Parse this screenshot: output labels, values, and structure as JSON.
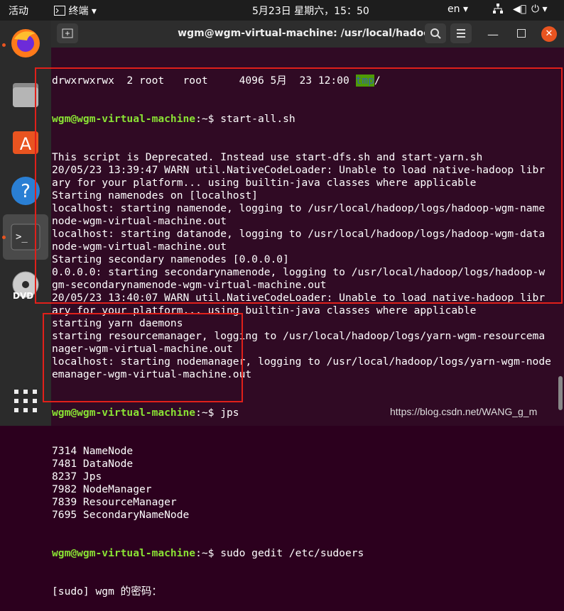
{
  "topbar": {
    "activities": "活动",
    "app_menu": "终端",
    "clock": "5月23日 星期六，15：50",
    "lang": "en"
  },
  "dock": {
    "apps": [
      "firefox-icon",
      "files-icon",
      "software-center-icon",
      "help-icon",
      "terminal-icon",
      "dvd-icon"
    ]
  },
  "window": {
    "title": "wgm@wgm-virtual-machine: /usr/local/hadoop"
  },
  "terminal": {
    "prompt": "wgm@wgm-virtual-machine",
    "path_sep": ":~$",
    "listing_prefix": "drwxrwxrwx  2 root   root     4096 5月  23 12:00 ",
    "listing_name": "tmp",
    "listing_suffix": "/",
    "cmd1": " start-all.sh",
    "out1": [
      "This script is Deprecated. Instead use start-dfs.sh and start-yarn.sh",
      "20/05/23 13:39:47 WARN util.NativeCodeLoader: Unable to load native-hadoop libr",
      "ary for your platform... using builtin-java classes where applicable",
      "Starting namenodes on [localhost]",
      "localhost: starting namenode, logging to /usr/local/hadoop/logs/hadoop-wgm-name",
      "node-wgm-virtual-machine.out",
      "localhost: starting datanode, logging to /usr/local/hadoop/logs/hadoop-wgm-data",
      "node-wgm-virtual-machine.out",
      "Starting secondary namenodes [0.0.0.0]",
      "0.0.0.0: starting secondarynamenode, logging to /usr/local/hadoop/logs/hadoop-w",
      "gm-secondarynamenode-wgm-virtual-machine.out",
      "20/05/23 13:40:07 WARN util.NativeCodeLoader: Unable to load native-hadoop libr",
      "ary for your platform... using builtin-java classes where applicable",
      "starting yarn daemons",
      "starting resourcemanager, logging to /usr/local/hadoop/logs/yarn-wgm-resourcema",
      "nager-wgm-virtual-machine.out",
      "localhost: starting nodemanager, logging to /usr/local/hadoop/logs/yarn-wgm-node",
      "emanager-wgm-virtual-machine.out"
    ],
    "cmd2": " jps",
    "out2": [
      "7314 NameNode",
      "7481 DataNode",
      "8237 Jps",
      "7982 NodeManager",
      "7839 ResourceManager",
      "7695 SecondaryNameNode"
    ],
    "cmd3": " sudo gedit /etc/sudoers",
    "out3": "[sudo] wgm 的密码："
  },
  "watermark": "https://blog.csdn.net/WANG_g_m",
  "colors": {
    "prompt": "#8ae234",
    "accent": "#e95420",
    "highlight_box": "#e0201a"
  }
}
